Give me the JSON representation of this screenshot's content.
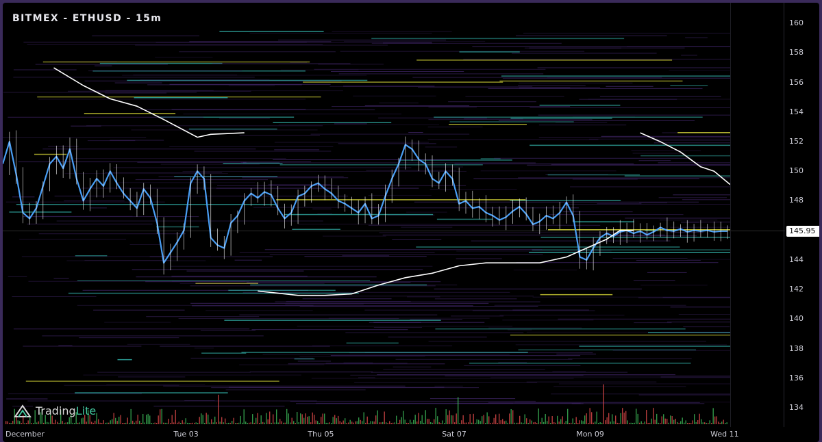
{
  "header": {
    "title": "BITMEX - ETHUSD - 15m"
  },
  "logo": {
    "brand_main": "Trading",
    "brand_accent": "Lite",
    "icon": "tradinglite-logo-icon"
  },
  "colors": {
    "price_line": "#4a9ff5",
    "wick": "#ffffff",
    "band": "#ffffff",
    "heat_purple": "#4b2c7a",
    "heat_teal": "#2fa7a0",
    "heat_yellow": "#e6e63a",
    "vol_red": "#e04a4a",
    "vol_green": "#3dbb5a"
  },
  "chart_data": {
    "type": "line",
    "title": "BITMEX - ETHUSD - 15m",
    "xlabel": "",
    "ylabel": "",
    "ylim": [
      132.7,
      161.4
    ],
    "y_ticks": [
      "134",
      "136",
      "138",
      "140",
      "142",
      "144",
      "146",
      "148",
      "150",
      "152",
      "154",
      "156",
      "158",
      "160"
    ],
    "x_tick_labels": [
      "December",
      "Tue 03",
      "Thu 05",
      "Sat 07",
      "Mon 09",
      "Wed 11"
    ],
    "x_tick_pos": [
      0,
      1.375,
      2.375,
      3.375,
      4.375,
      5.375
    ],
    "xlim": [
      0,
      5.42
    ],
    "last_price_label": "145.95",
    "last_price": 145.95,
    "grid": false,
    "series": [
      {
        "kind": "price",
        "x": [
          0,
          0.05,
          0.1,
          0.15,
          0.2,
          0.25,
          0.3,
          0.35,
          0.4,
          0.45,
          0.5,
          0.55,
          0.6,
          0.65,
          0.7,
          0.75,
          0.8,
          0.85,
          0.9,
          0.95,
          1.0,
          1.05,
          1.1,
          1.15,
          1.2,
          1.25,
          1.3,
          1.35,
          1.4,
          1.45,
          1.5,
          1.55,
          1.6,
          1.65,
          1.7,
          1.75,
          1.8,
          1.85,
          1.9,
          1.95,
          2.0,
          2.05,
          2.1,
          2.15,
          2.2,
          2.25,
          2.3,
          2.35,
          2.4,
          2.45,
          2.5,
          2.55,
          2.6,
          2.65,
          2.7,
          2.75,
          2.8,
          2.85,
          2.9,
          2.95,
          3.0,
          3.05,
          3.1,
          3.15,
          3.2,
          3.25,
          3.3,
          3.35,
          3.4,
          3.45,
          3.5,
          3.55,
          3.6,
          3.65,
          3.7,
          3.75,
          3.8,
          3.85,
          3.9,
          3.95,
          4.0,
          4.05,
          4.1,
          4.15,
          4.2,
          4.25,
          4.3,
          4.35,
          4.4,
          4.45,
          4.5,
          4.55,
          4.6,
          4.65,
          4.7,
          4.75,
          4.8,
          4.85,
          4.9,
          4.95,
          5.0,
          5.05,
          5.1,
          5.15,
          5.2,
          5.25,
          5.3,
          5.35,
          5.4
        ],
        "y": [
          150.5,
          152.0,
          149.8,
          147.2,
          146.8,
          147.5,
          149.0,
          150.5,
          151.0,
          150.2,
          151.5,
          149.5,
          148.0,
          148.8,
          149.5,
          149.0,
          150.0,
          149.2,
          148.5,
          148.0,
          147.5,
          148.8,
          148.2,
          146.5,
          143.8,
          144.5,
          145.2,
          146.0,
          149.2,
          150.0,
          149.5,
          145.5,
          145.0,
          144.8,
          146.5,
          147.0,
          148.0,
          148.5,
          148.2,
          148.6,
          148.4,
          147.5,
          146.8,
          147.2,
          148.3,
          148.5,
          149.0,
          149.2,
          148.8,
          148.5,
          148.0,
          147.8,
          147.5,
          147.2,
          147.8,
          146.8,
          147.0,
          148.3,
          149.5,
          150.5,
          151.8,
          151.5,
          150.8,
          150.5,
          149.5,
          149.2,
          150.0,
          149.5,
          147.8,
          148.0,
          147.5,
          147.6,
          147.2,
          147.0,
          146.7,
          146.9,
          147.3,
          147.6,
          147.1,
          146.4,
          146.6,
          147.0,
          146.8,
          147.2,
          147.9,
          147.0,
          144.2,
          144.0,
          144.8,
          145.5,
          145.8,
          145.6,
          145.9,
          146.0,
          145.8,
          145.95,
          145.7,
          145.9,
          146.2,
          146.0,
          145.95,
          146.1,
          145.9,
          146.0,
          145.95,
          146.0,
          145.9,
          145.95,
          145.95
        ]
      },
      {
        "kind": "band",
        "x": [
          0.38,
          0.6,
          0.8,
          1.0,
          1.2,
          1.45,
          1.55,
          1.8
        ],
        "y": [
          157.0,
          155.8,
          154.9,
          154.4,
          153.5,
          152.3,
          152.5,
          152.6
        ]
      },
      {
        "kind": "band",
        "x": [
          1.9,
          2.0,
          2.2,
          2.4,
          2.6,
          2.8,
          3.0,
          3.2,
          3.4,
          3.6,
          3.8,
          4.0,
          4.2,
          4.5,
          4.6,
          4.7
        ],
        "y": [
          141.9,
          141.8,
          141.6,
          141.6,
          141.7,
          142.3,
          142.8,
          143.1,
          143.6,
          143.8,
          143.8,
          143.8,
          144.2,
          145.4,
          146.0,
          146.0
        ]
      },
      {
        "kind": "band",
        "x": [
          4.75,
          4.9,
          5.05,
          5.2,
          5.3,
          5.42
        ],
        "y": [
          152.6,
          152.0,
          151.3,
          150.3,
          150.0,
          149.1
        ]
      }
    ]
  }
}
